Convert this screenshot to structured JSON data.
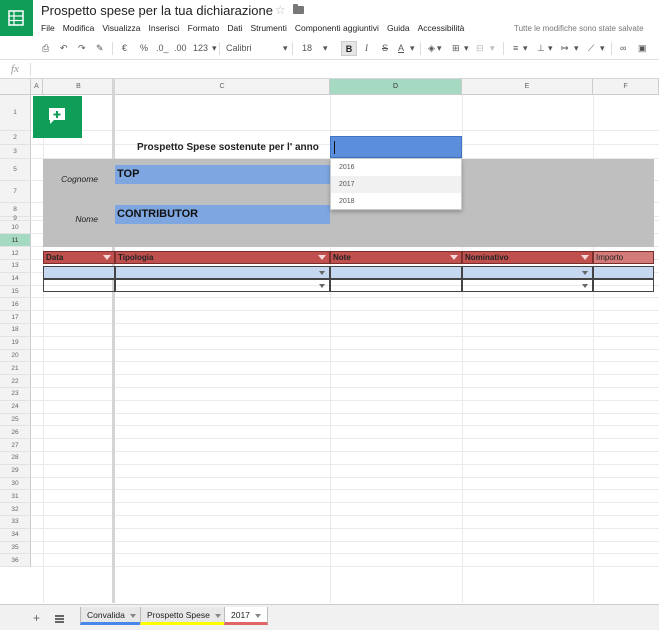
{
  "header": {
    "title": "Prospetto spese per la tua dichiarazione",
    "save_status": "Tutte le modifiche sono state salvate",
    "menu": [
      "File",
      "Modifica",
      "Visualizza",
      "Inserisci",
      "Formato",
      "Dati",
      "Strumenti",
      "Componenti aggiuntivi",
      "Guida",
      "Accessibilità"
    ]
  },
  "toolbar": {
    "currency": "€",
    "percent": "%",
    "decimal_less": ".0_",
    "decimal_more": ".00",
    "number_format": "123",
    "font": "Calibri",
    "font_size": "18",
    "bold": "B",
    "italic": "I",
    "strike": "S",
    "text_color": "A"
  },
  "formula_bar": {
    "fx": "fx"
  },
  "columns": [
    "A",
    "B",
    "C",
    "D",
    "E",
    "F"
  ],
  "rows": [
    "1",
    "2",
    "3",
    "5",
    "7",
    "8",
    "9",
    "10",
    "11",
    "12",
    "13",
    "14",
    "15",
    "16",
    "17",
    "18",
    "19",
    "20",
    "21",
    "22",
    "23",
    "24",
    "25",
    "26",
    "27",
    "28",
    "29",
    "30",
    "31",
    "32",
    "33",
    "34",
    "35",
    "36"
  ],
  "sheet": {
    "prospetto_label": "Prospetto Spese sostenute per l' anno",
    "year_options": [
      "2016",
      "2017",
      "2018"
    ],
    "cognome_label": "Cognome",
    "cognome_value": "TOP",
    "nome_label": "Nome",
    "nome_value": "CONTRIBUTOR",
    "table_headers": [
      "Data",
      "Tipologia",
      "Note",
      "Nominativo",
      "Importo"
    ]
  },
  "tabs": [
    {
      "label": "Convalida",
      "color": "#4a86e8"
    },
    {
      "label": "Prospetto Spese",
      "color": "#ffff00"
    },
    {
      "label": "2017",
      "color": "#e06666"
    }
  ],
  "colors": {
    "brand": "#0f9d58",
    "header_red": "#c0504d",
    "field_blue": "#7ea6e0",
    "selection_blue": "#5b8edb"
  }
}
